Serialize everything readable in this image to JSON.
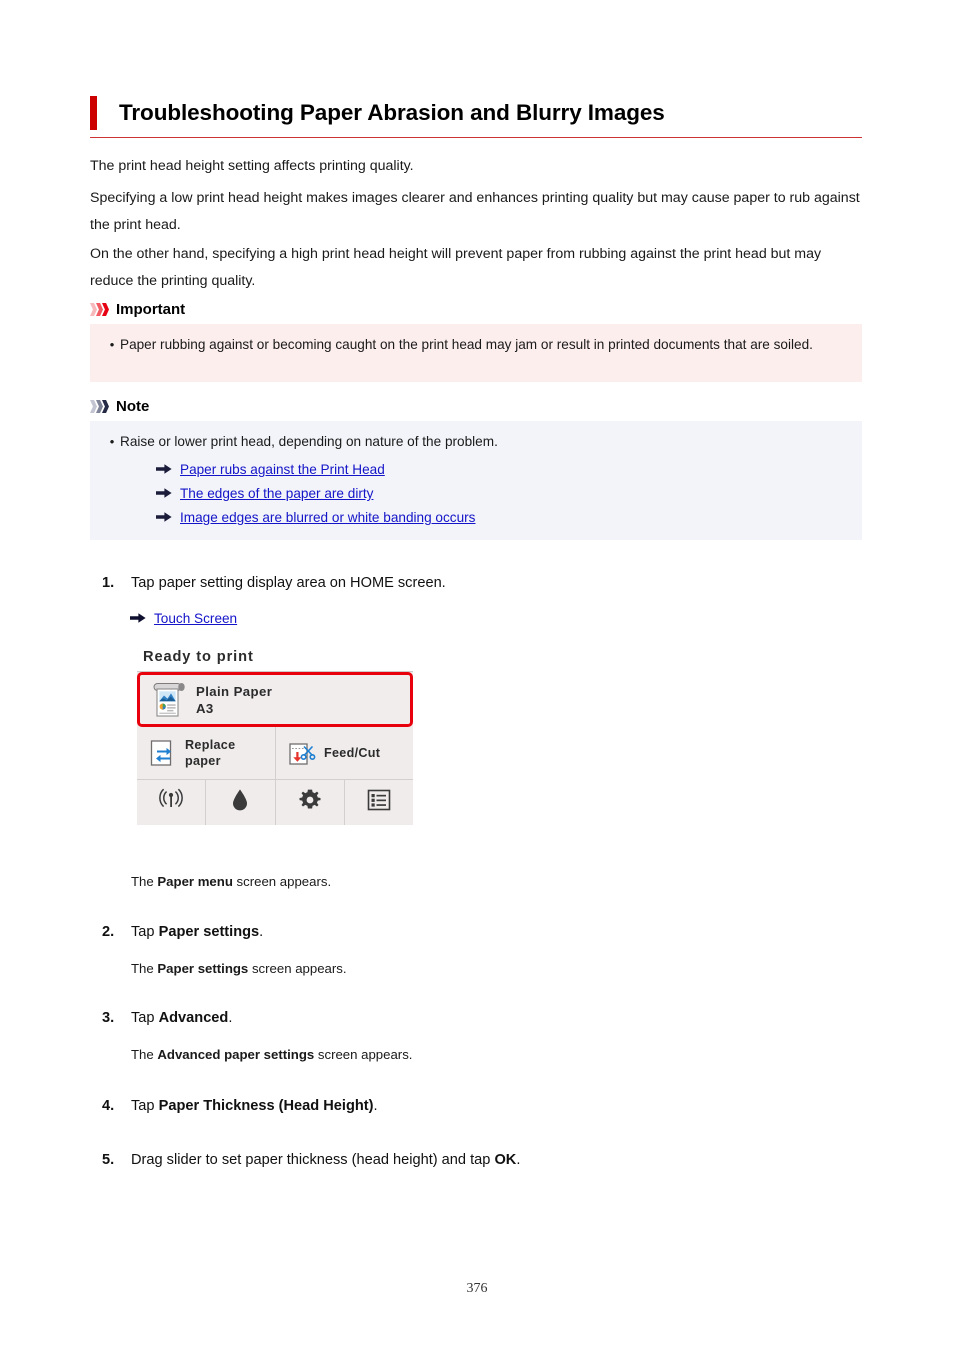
{
  "page": {
    "title": "Troubleshooting Paper Abrasion and Blurry Images",
    "page_number": "376",
    "accent_color": "#cc0000",
    "link_color": "#1414c8"
  },
  "intro": {
    "p1": "The print head height setting affects printing quality.",
    "p2": "Specifying a low print head height makes images clearer and enhances printing quality but may cause paper to rub against the print head.",
    "p3": "On the other hand, specifying a high print head height will prevent paper from rubbing against the print head but may reduce the printing quality."
  },
  "important": {
    "heading": "Important",
    "bullet_marker": "•",
    "background": "#fdeeee",
    "items": [
      "Paper rubbing against or becoming caught on the print head may jam or result in printed documents that are soiled."
    ]
  },
  "note": {
    "heading": "Note",
    "bullet_marker": "•",
    "background": "#f2f4f9",
    "items": [
      "Raise or lower print head, depending on nature of the problem."
    ],
    "links": [
      "Paper rubs against the Print Head",
      "The edges of the paper are dirty",
      "Image edges are blurred or white banding occurs"
    ]
  },
  "steps": [
    {
      "num": "1.",
      "text_prefix": "Tap paper setting display area on HOME screen.",
      "link": "Touch Screen",
      "result_prefix": "The ",
      "result_bold": "Paper menu",
      "result_suffix": " screen appears."
    },
    {
      "num": "2.",
      "text_prefix": "Tap ",
      "text_bold": "Paper settings",
      "text_suffix": ".",
      "result_prefix": "The ",
      "result_bold": "Paper settings",
      "result_suffix": " screen appears."
    },
    {
      "num": "3.",
      "text_prefix": "Tap ",
      "text_bold": "Advanced",
      "text_suffix": ".",
      "result_prefix": "The ",
      "result_bold": "Advanced paper settings",
      "result_suffix": " screen appears."
    },
    {
      "num": "4.",
      "text_prefix": "Tap ",
      "text_bold": "Paper Thickness (Head Height)",
      "text_suffix": "."
    },
    {
      "num": "5.",
      "text_prefix": "Drag slider to set paper thickness (head height) and tap ",
      "text_bold": "OK",
      "text_suffix": "."
    }
  ],
  "lcd": {
    "status": "Ready to print",
    "highlight_color": "#e8000d",
    "screen_background": "#f0ecec",
    "paper_row": {
      "media_type": "Plain Paper",
      "media_size": "A3",
      "icon": "roll-paper-icon"
    },
    "actions": [
      {
        "label_line1": "Replace",
        "label_line2": "paper",
        "icon": "replace-paper-icon"
      },
      {
        "label_line1": "Feed/Cut",
        "label_line2": "",
        "icon": "feed-cut-icon"
      }
    ],
    "toolbar": [
      {
        "icon": "wireless-lan-icon"
      },
      {
        "icon": "ink-drop-icon"
      },
      {
        "icon": "gear-icon"
      },
      {
        "icon": "list-menu-icon"
      }
    ]
  }
}
